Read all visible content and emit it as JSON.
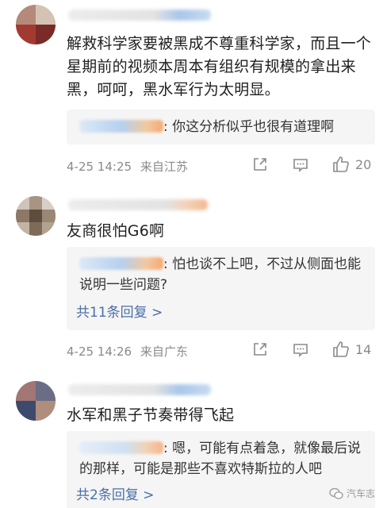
{
  "comments": [
    {
      "body": "解救科学家要被黑成不尊重科学家，而且一个星期前的视频本周本有组织有规模的拿出来黑，呵呵，黑水军行为太明显。",
      "reply": "你这分析似乎也很有道理啊",
      "time": "4-25 14:25",
      "location": "来自江苏",
      "likes": "20"
    },
    {
      "body": "友商很怕G6啊",
      "reply": "怕也谈不上吧，不过从侧面也能说明一些问题?",
      "more": "共11条回复 >",
      "time": "4-25 14:26",
      "location": "来自广东",
      "likes": "14"
    },
    {
      "body": "水军和黑子节奏带得飞起",
      "reply": "嗯，可能有点着急，就像最后说的那样，可能是那些不喜欢特斯拉的人吧",
      "more": "共2条回复 >"
    }
  ],
  "watermark": "汽车志",
  "colors": {
    "link": "#4a6fa8",
    "meta": "#8a8a8a",
    "reply_bg": "#f5f5f5"
  }
}
